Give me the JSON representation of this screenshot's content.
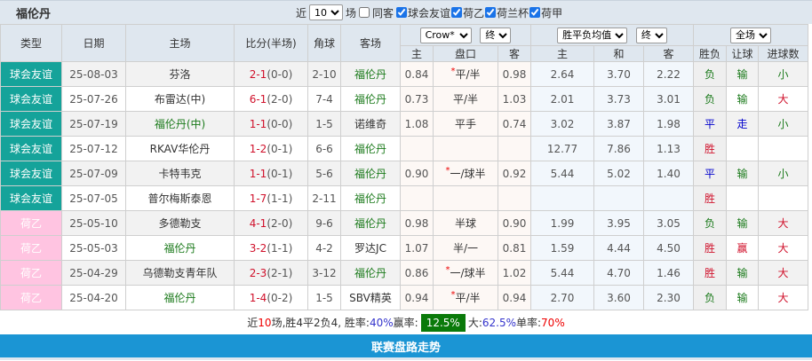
{
  "title": "福伦丹",
  "filters": {
    "near": "近",
    "count": "10",
    "unit": "场",
    "same": "同客",
    "same_checked": false,
    "leagues": [
      {
        "label": "球会友谊",
        "checked": true
      },
      {
        "label": "荷乙",
        "checked": true
      },
      {
        "label": "荷兰杯",
        "checked": true
      },
      {
        "label": "荷甲",
        "checked": true
      }
    ]
  },
  "header": {
    "type": "类型",
    "date": "日期",
    "home": "主场",
    "score": "比分(半场)",
    "corner": "角球",
    "away": "客场",
    "company": "Crow*",
    "company_time": "终",
    "avg": "胜平负均值",
    "avg_time": "终",
    "scope": "全场",
    "sub": [
      "主",
      "盘口",
      "客",
      "主",
      "和",
      "客",
      "胜负",
      "让球",
      "进球数"
    ]
  },
  "colors": {
    "friendly": "#15a39a",
    "eredivisie2": "#ffc4e1",
    "button": "#1b95d4",
    "badge": "#0a7a0a"
  },
  "rows": [
    {
      "type": "球会友谊",
      "tc": "f",
      "date": "25-08-03",
      "home": "芬洛",
      "hg": false,
      "ft": "2-1",
      "ht": "(0-0)",
      "corner": "2-10",
      "away": "福伦丹",
      "ag": true,
      "oh": "0.84",
      "hc": "平/半",
      "star": true,
      "oa": "0.98",
      "w": "2.64",
      "d": "3.70",
      "l": "2.22",
      "r": "负",
      "rc": "green",
      "h": "输",
      "hcc": "green",
      "g": "小",
      "gc": "green"
    },
    {
      "type": "球会友谊",
      "tc": "f",
      "date": "25-07-26",
      "home": "布雷达(中)",
      "hg": false,
      "ft": "6-1",
      "ht": "(2-0)",
      "corner": "7-4",
      "away": "福伦丹",
      "ag": true,
      "oh": "0.73",
      "hc": "平/半",
      "star": false,
      "oa": "1.03",
      "w": "2.01",
      "d": "3.73",
      "l": "3.01",
      "r": "负",
      "rc": "green",
      "h": "输",
      "hcc": "green",
      "g": "大",
      "gc": "red"
    },
    {
      "type": "球会友谊",
      "tc": "f",
      "date": "25-07-19",
      "home": "福伦丹(中)",
      "hg": true,
      "ft": "1-1",
      "ht": "(0-0)",
      "corner": "1-5",
      "away": "诺维奇",
      "ag": false,
      "oh": "1.08",
      "hc": "平手",
      "star": false,
      "oa": "0.74",
      "w": "3.02",
      "d": "3.87",
      "l": "1.98",
      "r": "平",
      "rc": "blue",
      "h": "走",
      "hcc": "blue",
      "g": "小",
      "gc": "green"
    },
    {
      "type": "球会友谊",
      "tc": "f",
      "date": "25-07-12",
      "home": "RKAV华伦丹",
      "hg": false,
      "ft": "1-2",
      "ht": "(0-1)",
      "corner": "6-6",
      "away": "福伦丹",
      "ag": true,
      "oh": "",
      "hc": "",
      "star": false,
      "oa": "",
      "w": "12.77",
      "d": "7.86",
      "l": "1.13",
      "r": "胜",
      "rc": "red",
      "h": "",
      "hcc": "",
      "g": "",
      "gc": ""
    },
    {
      "type": "球会友谊",
      "tc": "f",
      "date": "25-07-09",
      "home": "卡特韦克",
      "hg": false,
      "ft": "1-1",
      "ht": "(0-1)",
      "corner": "5-6",
      "away": "福伦丹",
      "ag": true,
      "oh": "0.90",
      "hc": "一/球半",
      "star": true,
      "oa": "0.92",
      "w": "5.44",
      "d": "5.02",
      "l": "1.40",
      "r": "平",
      "rc": "blue",
      "h": "输",
      "hcc": "green",
      "g": "小",
      "gc": "green"
    },
    {
      "type": "球会友谊",
      "tc": "f",
      "date": "25-07-05",
      "home": "普尔梅斯泰恩",
      "hg": false,
      "ft": "1-7",
      "ht": "(1-1)",
      "corner": "2-11",
      "away": "福伦丹",
      "ag": true,
      "oh": "",
      "hc": "",
      "star": false,
      "oa": "",
      "w": "",
      "d": "",
      "l": "",
      "r": "胜",
      "rc": "red",
      "h": "",
      "hcc": "",
      "g": "",
      "gc": ""
    },
    {
      "type": "荷乙",
      "tc": "e",
      "date": "25-05-10",
      "home": "多德勒支",
      "hg": false,
      "ft": "4-1",
      "ht": "(2-0)",
      "corner": "9-6",
      "away": "福伦丹",
      "ag": true,
      "oh": "0.98",
      "hc": "半球",
      "star": false,
      "oa": "0.90",
      "w": "1.99",
      "d": "3.95",
      "l": "3.05",
      "r": "负",
      "rc": "green",
      "h": "输",
      "hcc": "green",
      "g": "大",
      "gc": "red"
    },
    {
      "type": "荷乙",
      "tc": "e",
      "date": "25-05-03",
      "home": "福伦丹",
      "hg": true,
      "ft": "3-2",
      "ht": "(1-1)",
      "corner": "4-2",
      "away": "罗达JC",
      "ag": false,
      "oh": "1.07",
      "hc": "半/一",
      "star": false,
      "oa": "0.81",
      "w": "1.59",
      "d": "4.44",
      "l": "4.50",
      "r": "胜",
      "rc": "red",
      "h": "赢",
      "hcc": "red",
      "g": "大",
      "gc": "red"
    },
    {
      "type": "荷乙",
      "tc": "e",
      "date": "25-04-29",
      "home": "乌德勒支青年队",
      "hg": false,
      "ft": "2-3",
      "ht": "(2-1)",
      "corner": "3-12",
      "away": "福伦丹",
      "ag": true,
      "oh": "0.86",
      "hc": "一/球半",
      "star": true,
      "oa": "1.02",
      "w": "5.44",
      "d": "4.70",
      "l": "1.46",
      "r": "胜",
      "rc": "red",
      "h": "输",
      "hcc": "green",
      "g": "大",
      "gc": "red"
    },
    {
      "type": "荷乙",
      "tc": "e",
      "date": "25-04-20",
      "home": "福伦丹",
      "hg": true,
      "ft": "1-4",
      "ht": "(0-2)",
      "corner": "1-5",
      "away": "SBV精英",
      "ag": false,
      "oh": "0.94",
      "hc": "平/半",
      "star": true,
      "oa": "0.94",
      "w": "2.70",
      "d": "3.60",
      "l": "2.30",
      "r": "负",
      "rc": "green",
      "h": "输",
      "hcc": "green",
      "g": "大",
      "gc": "red"
    }
  ],
  "summary": {
    "p1": "近",
    "n": "10",
    "p2": "场,胜4平2负4, 胜率:",
    "win": "40%",
    "p3": " 赢率:",
    "handicap": "12.5%",
    "p4": " 大:",
    "over": "62.5%",
    "p5": " 单率:",
    "odd": "70%"
  },
  "button": "联赛盘路走势"
}
